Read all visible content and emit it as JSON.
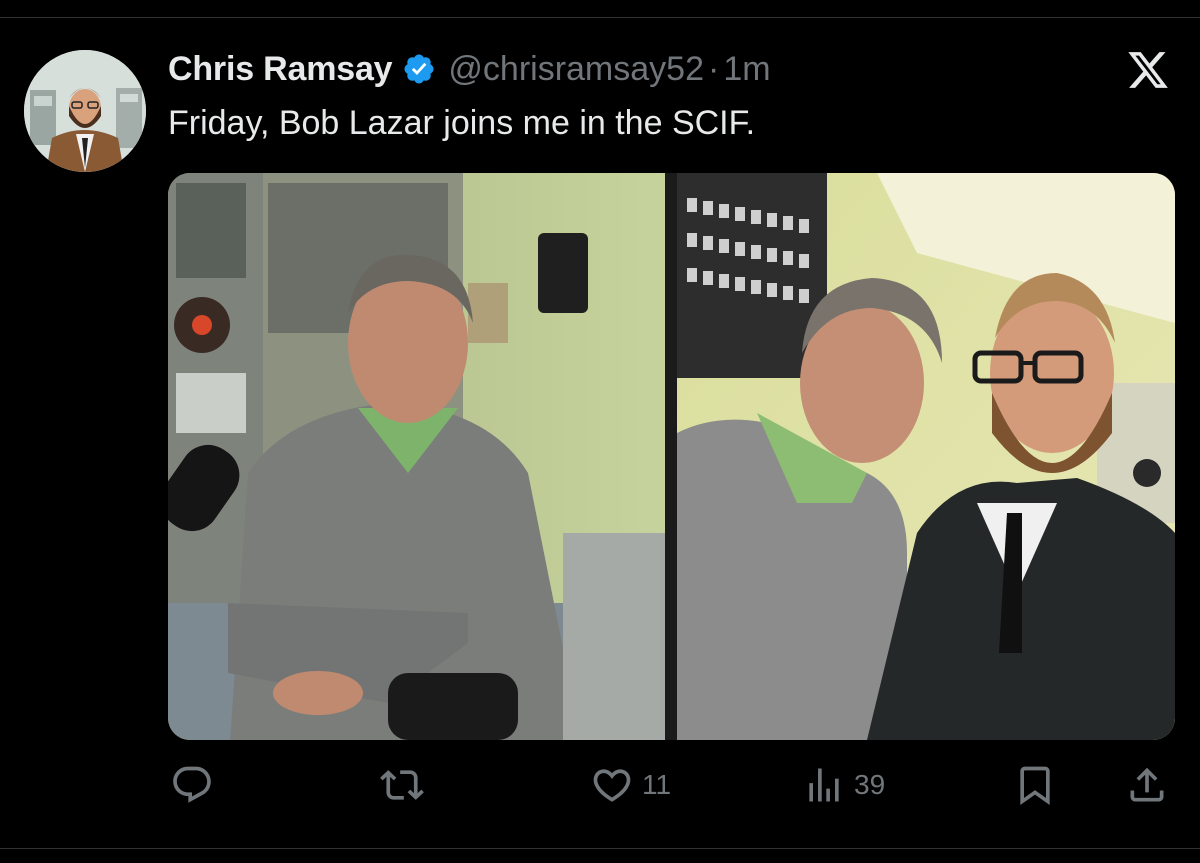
{
  "tweet": {
    "author_name": "Chris Ramsay",
    "handle": "@chrisramsay52",
    "separator": "·",
    "time": "1m",
    "text": "Friday, Bob Lazar joins me in the SCIF."
  },
  "actions": {
    "likes": "11",
    "views": "39"
  },
  "colors": {
    "background": "#000000",
    "text": "#e7e9ea",
    "muted": "#71767b",
    "verified": "#1d9bf0"
  },
  "icons": {
    "verified": "verified-badge-icon",
    "brand": "x-logo-icon",
    "reply": "reply-icon",
    "repost": "repost-icon",
    "like": "heart-icon",
    "views": "views-icon",
    "bookmark": "bookmark-icon",
    "share": "share-icon"
  }
}
